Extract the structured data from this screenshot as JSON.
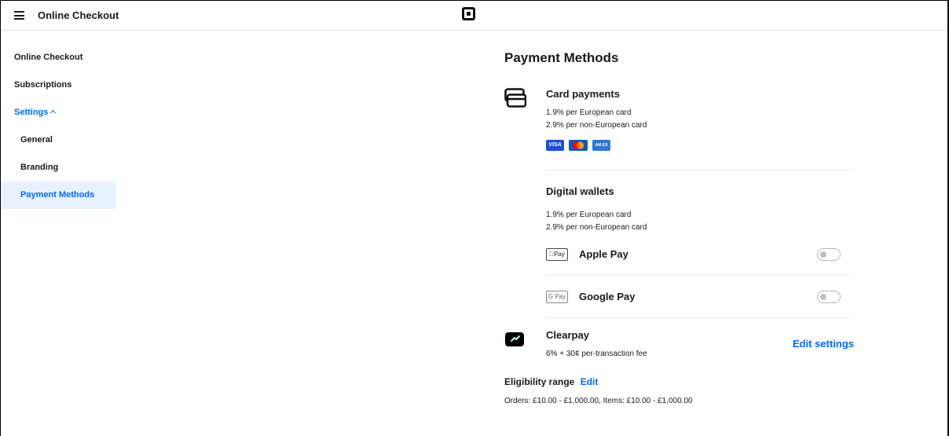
{
  "header": {
    "menu_icon": "hamburger-icon",
    "title": "Online Checkout",
    "logo_icon": "square-logo-icon"
  },
  "sidebar": {
    "items": [
      {
        "label": "Online Checkout"
      },
      {
        "label": "Subscriptions"
      },
      {
        "label": "Settings"
      },
      {
        "label": "General"
      },
      {
        "label": "Branding"
      },
      {
        "label": "Payment Methods"
      }
    ]
  },
  "main": {
    "title": "Payment Methods",
    "card_payments": {
      "title": "Card payments",
      "fee_eu": "1.9% per European card",
      "fee_non_eu": "2.9% per non-European card",
      "brands": [
        "VISA",
        "",
        "AM EX"
      ]
    },
    "digital_wallets": {
      "title": "Digital wallets",
      "fee_eu": "1.9% per European card",
      "fee_non_eu": "2.9% per non-European card",
      "apple_pay": {
        "logo": "Pay",
        "name": "Apple Pay",
        "enabled": false
      },
      "google_pay": {
        "logo": "G Pay",
        "name": "Google Pay",
        "enabled": false
      }
    },
    "clearpay": {
      "title": "Clearpay",
      "fee": "6% + 30¢ per-transaction fee",
      "edit_label": "Edit settings"
    },
    "eligibility": {
      "title": "Eligibility range",
      "edit_label": "Edit",
      "text": "Orders: £10.00 - £1,000.00, Items: £10.00 - £1,000.00"
    }
  },
  "colors": {
    "accent": "#006aff",
    "active_bg": "#e8f1ff",
    "visa": "#1a4fd6",
    "mastercard": "#0f5ab5",
    "amex": "#2e77d0",
    "clearpay_icon": "#000000"
  }
}
